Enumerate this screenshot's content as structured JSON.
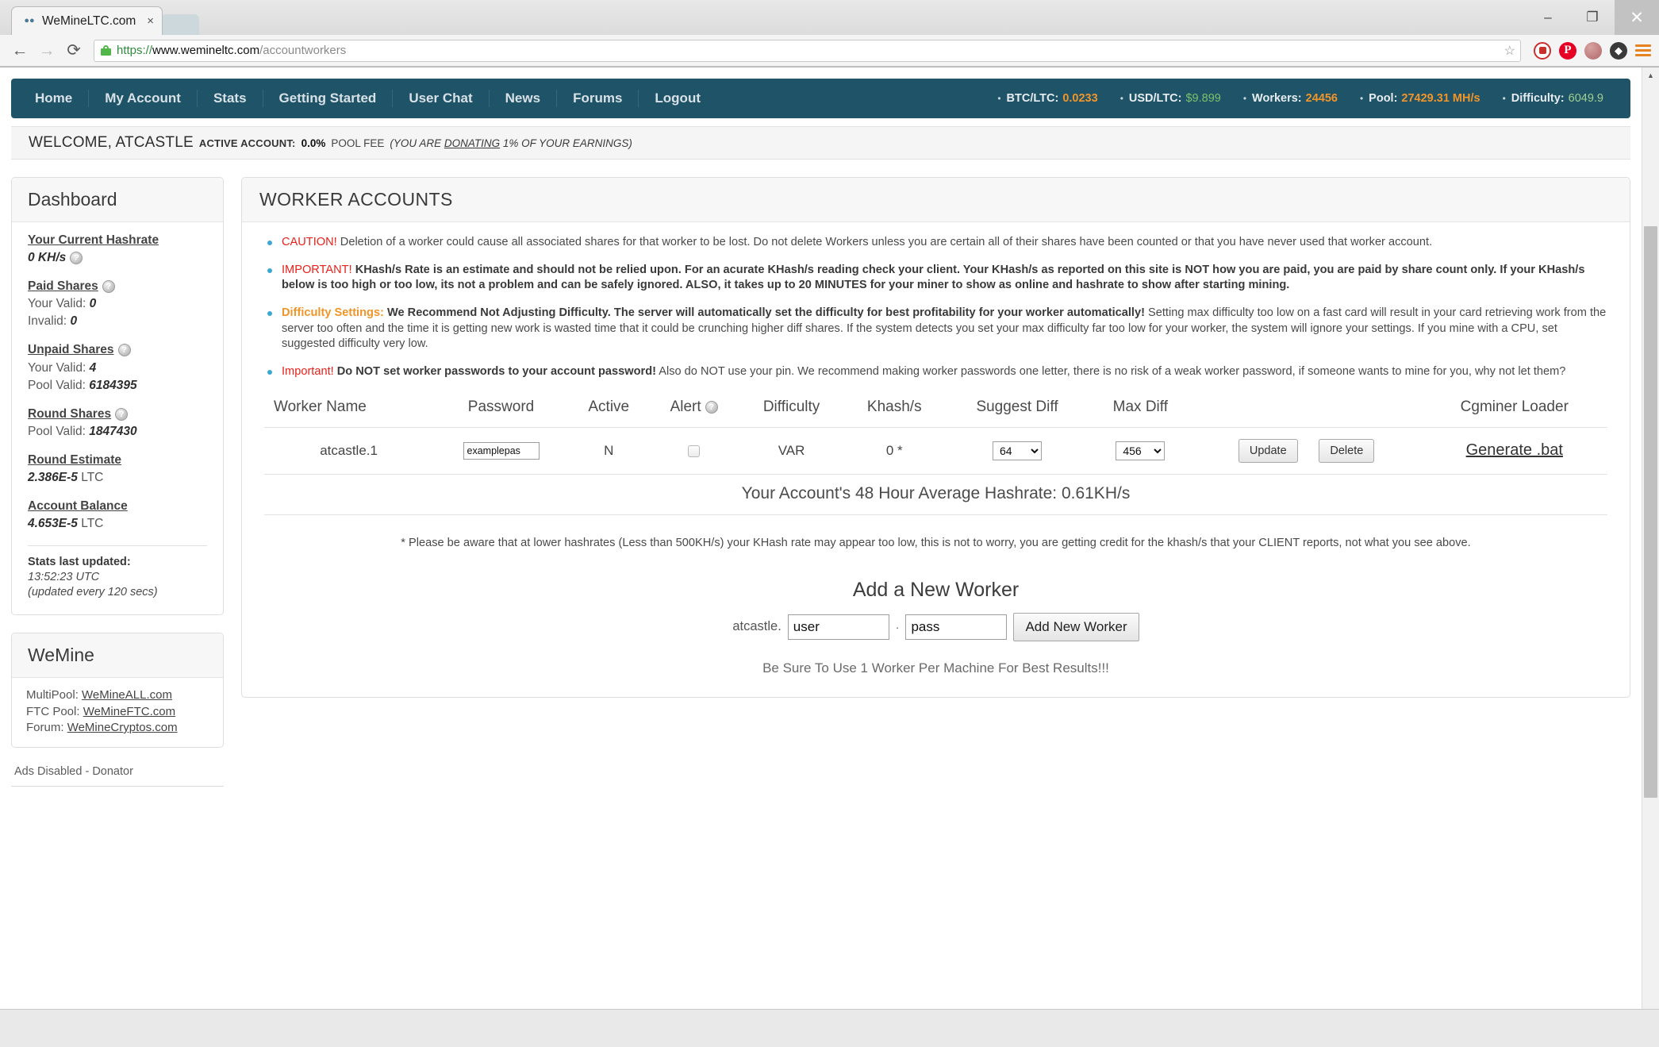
{
  "browser": {
    "tab_title": "WeMineLTC.com",
    "tab_close": "×",
    "url_scheme": "https://",
    "url_host": "www.wemineltc.com",
    "url_path": "/accountworkers",
    "back_icon": "←",
    "forward_icon": "→",
    "reload_icon": "⟳",
    "star_icon": "☆",
    "minimize": "–",
    "maximize": "❐",
    "close": "✕",
    "pinterest_glyph": "P",
    "evernote_glyph": "◆",
    "scroll_up_arrow": "▲"
  },
  "nav": {
    "links": [
      "Home",
      "My Account",
      "Stats",
      "Getting Started",
      "User Chat",
      "News",
      "Forums",
      "Logout"
    ],
    "stats": [
      {
        "label": "BTC/LTC:",
        "value": "0.0233",
        "color": "#f0952a"
      },
      {
        "label": "USD/LTC:",
        "value": "$9.899",
        "color": "#79c36b"
      },
      {
        "label": "Workers:",
        "value": "24456",
        "color": "#f0952a"
      },
      {
        "label": "Pool:",
        "value": "27429.31 MH/s",
        "color": "#f0952a"
      },
      {
        "label": "Difficulty:",
        "value": "6049.9",
        "color": "#9fd08f"
      }
    ]
  },
  "welcome": {
    "title": "WELCOME, ATCASTLE",
    "active_label": "ACTIVE ACCOUNT:",
    "fee": "0.0%",
    "fee_label": "POOL FEE",
    "note_pre": "(YOU ARE ",
    "note_link": "DONATING",
    "note_post": " 1% OF YOUR EARNINGS)"
  },
  "sidebar": {
    "dashboard_title": "Dashboard",
    "help_glyph": "?",
    "groups": [
      {
        "title": "Your Current Hashrate",
        "has_help_on_value": true,
        "value_line": "0 KH/s"
      },
      {
        "title": "Paid Shares",
        "rows": [
          {
            "label": "Your Valid:",
            "value": "0"
          },
          {
            "label": "Invalid:",
            "value": "0"
          }
        ]
      },
      {
        "title": "Unpaid Shares",
        "rows": [
          {
            "label": "Your Valid:",
            "value": "4"
          },
          {
            "label": "Pool Valid:",
            "value": "6184395"
          }
        ]
      },
      {
        "title": "Round Shares",
        "rows": [
          {
            "label": "Pool Valid:",
            "value": "1847430"
          }
        ]
      },
      {
        "title": "Round Estimate",
        "big_value": "2.386E-5",
        "big_unit": "LTC"
      },
      {
        "title": "Account Balance",
        "big_value": "4.653E-5",
        "big_unit": "LTC"
      }
    ],
    "updated_title": "Stats last updated:",
    "updated_time": "13:52:23 UTC",
    "updated_every": "(updated every 120 secs)",
    "wemine_title": "WeMine",
    "wemine_links": [
      {
        "label": "MultiPool:",
        "link": "WeMineALL.com"
      },
      {
        "label": "FTC Pool:",
        "link": "WeMineFTC.com"
      },
      {
        "label": "Forum:",
        "link": "WeMineCryptos.com"
      }
    ],
    "ads_note": "Ads Disabled - Donator"
  },
  "main": {
    "title": "WORKER ACCOUNTS",
    "notices": [
      {
        "tag": "CAUTION!",
        "tag_color": "red",
        "body": " Deletion of a worker could cause all associated shares for that worker to be lost. Do not delete Workers unless you are certain all of their shares have been counted or that you have never used that worker account.",
        "bold_body": ""
      },
      {
        "tag": "IMPORTANT!",
        "tag_color": "red",
        "bold_body": " KHash/s Rate is an estimate and should not be relied upon. For an acurate KHash/s reading check your client. Your KHash/s as reported on this site is NOT how you are paid, you are paid by share count only. If your KHash/s below is too high or too low, its not a problem and can be safely ignored. ALSO, it takes up to 20 MINUTES for your miner to show as online and hashrate to show after starting mining.",
        "body": ""
      },
      {
        "tag": "Difficulty Settings:",
        "tag_color": "orange",
        "bold_body": " We Recommend Not Adjusting Difficulty. The server will automatically set the difficulty for best profitability for your worker automatically!",
        "body": " Setting max difficulty too low on a fast card will result in your card retrieving work from the server too often and the time it is getting new work is wasted time that it could be crunching higher diff shares. If the system detects you set your max difficulty far too low for your worker, the system will ignore your settings. If you mine with a CPU, set suggested difficulty very low."
      },
      {
        "tag": "Important!",
        "tag_color": "red",
        "bold_body": " Do NOT set worker passwords to your account password!",
        "body": " Also do NOT use your pin. We recommend making worker passwords one letter, there is no risk of a weak worker password, if someone wants to mine for you, why not let them?"
      }
    ],
    "table": {
      "headers": [
        "Worker Name",
        "Password",
        "Active",
        "Alert",
        "Difficulty",
        "Khash/s",
        "Suggest Diff",
        "Max Diff",
        "",
        "Cgminer Loader"
      ],
      "alert_help_glyph": "?",
      "rows": [
        {
          "name": "atcastle.1",
          "password": "examplepas",
          "active": "N",
          "difficulty": "VAR",
          "khash": "0 *",
          "suggest_diff": "64",
          "max_diff": "456",
          "update_label": "Update",
          "delete_label": "Delete",
          "cgminer_link": "Generate .bat"
        }
      ]
    },
    "avg_hashrate": "Your Account's 48 Hour Average Hashrate: 0.61KH/s",
    "star_note": "* Please be aware that at lower hashrates (Less than 500KH/s) your KHash rate may appear too low, this is not to worry, you are getting credit for the khash/s that your CLIENT reports, not what you see above.",
    "add_worker_title": "Add a New Worker",
    "add_prefix": "atcastle.",
    "add_user_value": "user",
    "add_sep": "·",
    "add_pass_value": "pass",
    "add_button": "Add New Worker",
    "add_note": "Be Sure To Use 1 Worker Per Machine For Best Results!!!"
  }
}
